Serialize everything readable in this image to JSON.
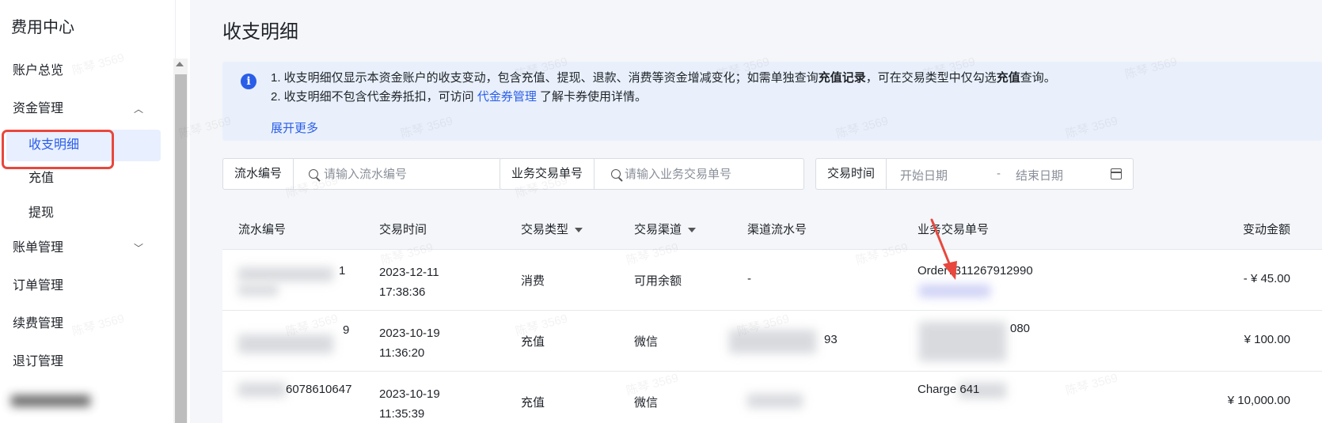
{
  "sidebar": {
    "title": "费用中心",
    "items": [
      {
        "label": "账户总览"
      },
      {
        "label": "资金管理",
        "expanded": true
      },
      {
        "label": "收支明细",
        "active": true
      },
      {
        "label": "充值"
      },
      {
        "label": "提现"
      },
      {
        "label": "账单管理",
        "expanded": false
      },
      {
        "label": "订单管理"
      },
      {
        "label": "续费管理"
      },
      {
        "label": "退订管理"
      }
    ]
  },
  "page": {
    "title": "收支明细"
  },
  "notice": {
    "line1_prefix": "1. 收支明细仅显示本资金账户的收支变动，包含充值、提现、退款、消费等资金增减变化；如需单独查询",
    "line1_bold1": "充值记录",
    "line1_mid": "，可在交易类型中仅勾选",
    "line1_bold2": "充值",
    "line1_suffix": "查询。",
    "line2_prefix": "2. 收支明细不包含代金券抵扣，可访问 ",
    "line2_link": "代金券管理",
    "line2_suffix": " 了解卡券使用详情。",
    "expand_label": "展开更多"
  },
  "filters": {
    "serial": {
      "label": "流水编号",
      "placeholder": "请输入流水编号"
    },
    "order": {
      "label": "业务交易单号",
      "placeholder": "请输入业务交易单号"
    },
    "time": {
      "label": "交易时间",
      "start_placeholder": "开始日期",
      "separator": "-",
      "end_placeholder": "结束日期"
    }
  },
  "table": {
    "columns": [
      "流水编号",
      "交易时间",
      "交易类型",
      "交易渠道",
      "渠道流水号",
      "业务交易单号",
      "变动金额"
    ],
    "rows": [
      {
        "serial": "1",
        "date": "2023-12-11",
        "time": "17:38:36",
        "type": "消费",
        "channel": "可用余额",
        "channel_serial": "-",
        "order": "Order7311267912990",
        "amount": "- ¥ 45.00"
      },
      {
        "serial": "9",
        "date": "2023-10-19",
        "time": "11:36:20",
        "type": "充值",
        "channel": "微信",
        "channel_serial": "93",
        "order": "080",
        "amount": "¥ 100.00"
      },
      {
        "serial": "6078610647",
        "date": "2023-10-19",
        "time": "11:35:39",
        "type": "充值",
        "channel": "微信",
        "channel_serial": "",
        "order": "Charge 641",
        "amount": "¥ 10,000.00"
      }
    ]
  },
  "watermark": "陈琴 3569",
  "colors": {
    "accent": "#2a5ee8",
    "highlight_border": "#e8473d",
    "arrow": "#e8473d"
  }
}
